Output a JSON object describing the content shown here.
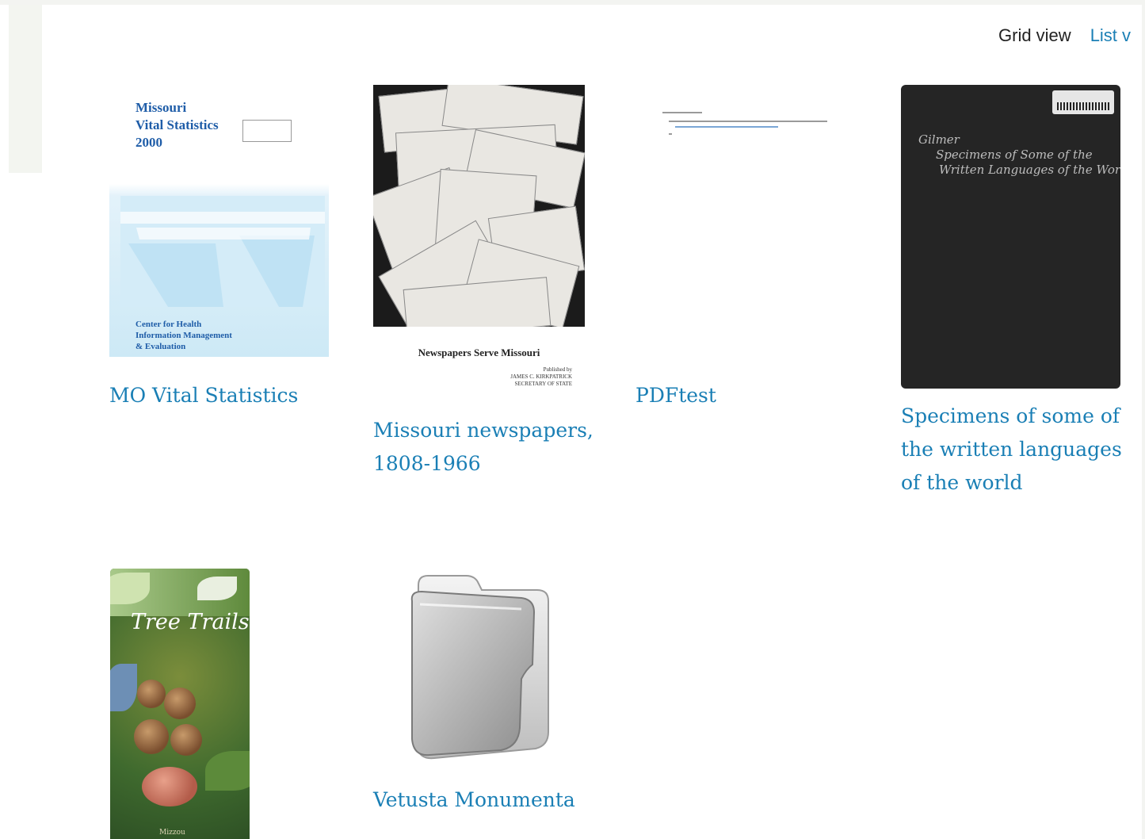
{
  "view_toggle": {
    "grid_label": "Grid view",
    "list_label": "List v"
  },
  "items": [
    {
      "title": "MO Vital Statistics",
      "thumb_text": {
        "heading_lines": [
          "Missouri",
          "Vital Statistics",
          "2000"
        ],
        "footer_lines": [
          "Center for Health",
          "Information Management",
          "& Evaluation"
        ]
      }
    },
    {
      "title_lines": [
        "Missouri newspapers,",
        "1808-1966"
      ],
      "thumb_text": {
        "caption": "Newspapers Serve Missouri",
        "publisher_lines": [
          "Published by",
          "JAMES C. KIRKPATRICK",
          "SECRETARY OF STATE"
        ]
      }
    },
    {
      "title": "PDFtest"
    },
    {
      "title_lines": [
        "Specimens of some of",
        "the written languages",
        "of the world"
      ],
      "thumb_text": {
        "handwriting_lines": [
          "Gilmer",
          "Specimens of Some of the",
          "Written Languages of the World"
        ]
      }
    },
    {
      "thumb_text": {
        "title": "Tree Trails",
        "footer": "Mizzou"
      }
    },
    {
      "title": "Vetusta Monumenta"
    }
  ]
}
